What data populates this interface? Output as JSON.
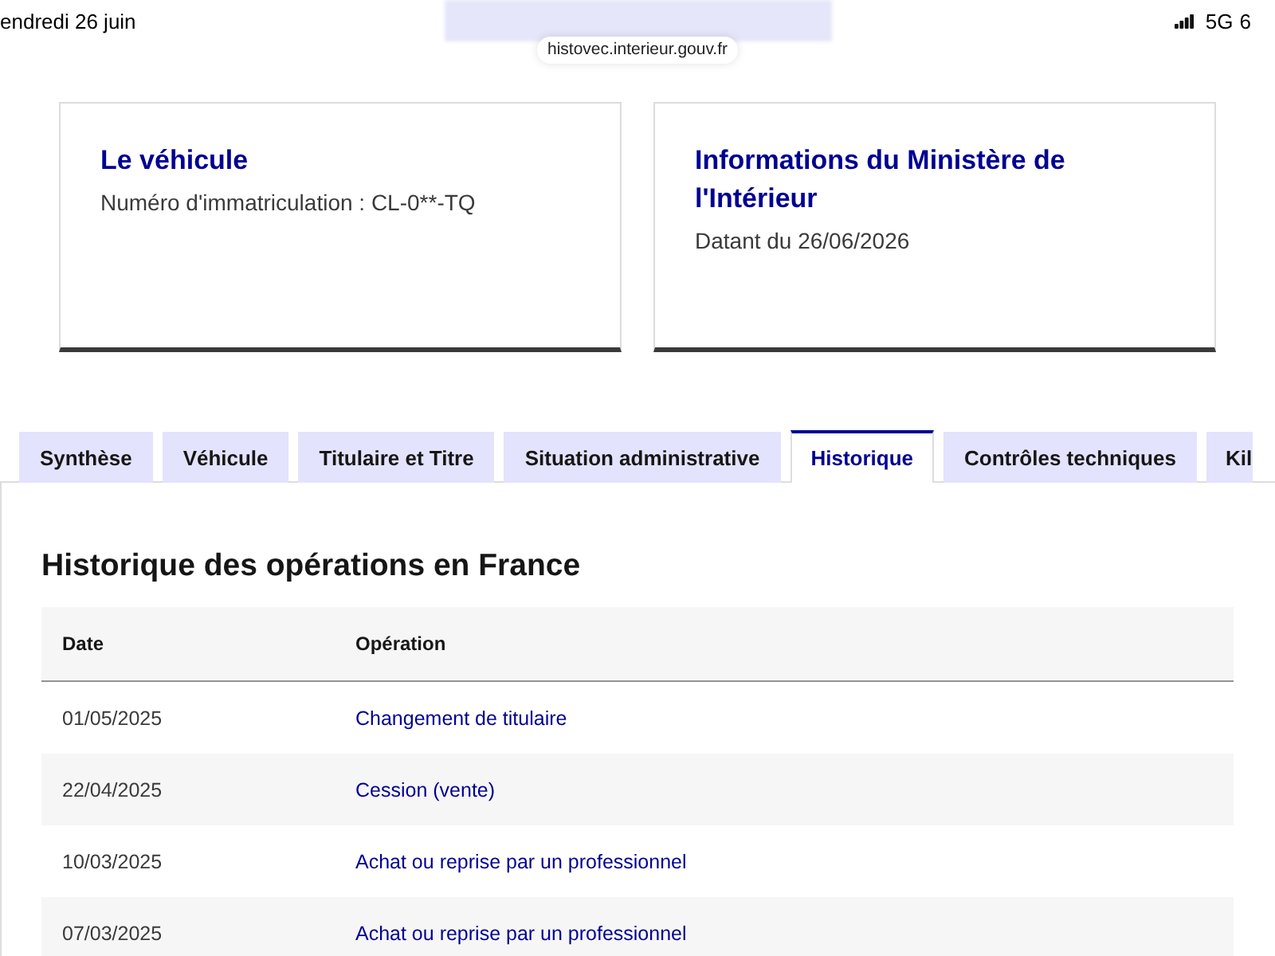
{
  "status_bar": {
    "date": "endredi 26 juin",
    "network": "5G",
    "battery": "6"
  },
  "address_bar": {
    "url": "histovec.interieur.gouv.fr"
  },
  "cards": [
    {
      "title": "Le véhicule",
      "text": "Numéro d'immatriculation : CL-0**-TQ"
    },
    {
      "title": "Informations du Ministère de l'Intérieur",
      "text": "Datant du 26/06/2026"
    }
  ],
  "tabs": [
    {
      "label": "Synthèse",
      "selected": false
    },
    {
      "label": "Véhicule",
      "selected": false
    },
    {
      "label": "Titulaire et Titre",
      "selected": false
    },
    {
      "label": "Situation administrative",
      "selected": false
    },
    {
      "label": "Historique",
      "selected": true
    },
    {
      "label": "Contrôles techniques",
      "selected": false
    },
    {
      "label": "Kil",
      "selected": false
    }
  ],
  "panel": {
    "heading": "Historique des opérations en France",
    "table": {
      "columns": [
        "Date",
        "Opération"
      ],
      "rows": [
        {
          "date": "01/05/2025",
          "operation": "Changement de titulaire"
        },
        {
          "date": "22/04/2025",
          "operation": "Cession (vente)"
        },
        {
          "date": "10/03/2025",
          "operation": "Achat ou reprise par un professionnel"
        },
        {
          "date": "07/03/2025",
          "operation": "Achat ou reprise par un professionnel"
        }
      ]
    }
  }
}
